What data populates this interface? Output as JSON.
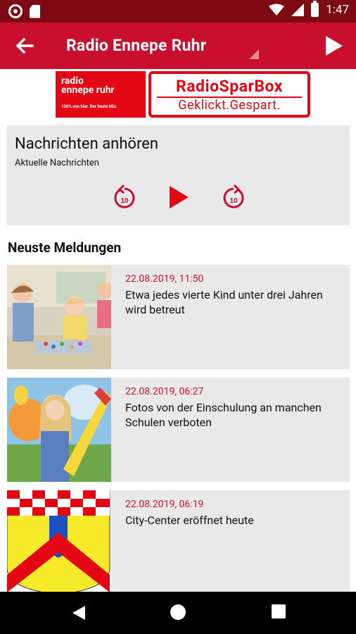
{
  "status_bar": {
    "time": "1:47",
    "icons": [
      "notification-circle-icon",
      "sim-card-icon",
      "wifi-icon",
      "signal-icon",
      "battery-icon"
    ]
  },
  "app_bar": {
    "title": "Radio Ennepe Ruhr",
    "back_icon": "arrow-left-icon",
    "play_icon": "play-icon",
    "background_color": "#c8102e"
  },
  "banner": {
    "logo_left_line1": "radio",
    "logo_left_line2": "ennepe ruhr",
    "logo_left_tagline": "100% von hier. Der beste Mix.",
    "logo_right_top": "RadioSparBox",
    "logo_right_bottom": "Geklickt.Gespart."
  },
  "audio_panel": {
    "heading": "Nachrichten anhören",
    "subtitle": "Aktuelle Nachrichten",
    "rewind_label": "10",
    "forward_label": "10"
  },
  "section_title": "Neuste Meldungen",
  "news": [
    {
      "date": "22.08.2019, 11:50",
      "title": "Etwa jedes vierte Kind unter drei Jahren wird betreut",
      "image": "children-playing-image"
    },
    {
      "date": "22.08.2019, 06:27",
      "title": "Fotos von der Einschulung an manchen Schulen verboten",
      "image": "girl-school-cone-image"
    },
    {
      "date": "22.08.2019, 06:19",
      "title": "City-Center eröffnet heute",
      "image": "coat-of-arms-image"
    }
  ],
  "accent_color": "#c8102e"
}
